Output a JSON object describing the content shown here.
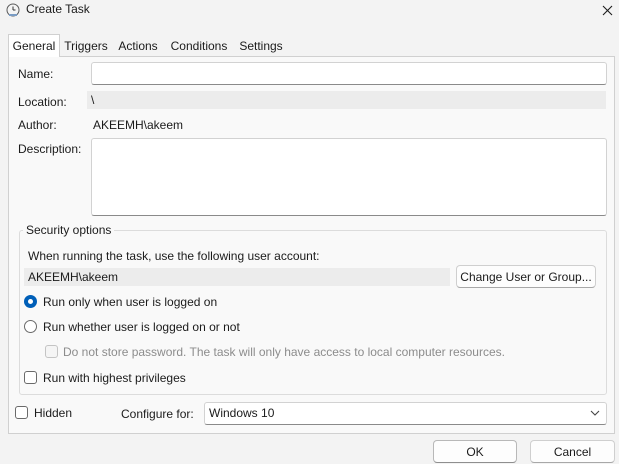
{
  "window": {
    "title": "Create Task",
    "icon": "task-scheduler-clock-icon"
  },
  "tabs": [
    {
      "label": "General",
      "active": true
    },
    {
      "label": "Triggers",
      "active": false
    },
    {
      "label": "Actions",
      "active": false
    },
    {
      "label": "Conditions",
      "active": false
    },
    {
      "label": "Settings",
      "active": false
    }
  ],
  "general": {
    "name_label": "Name:",
    "name_value": "",
    "location_label": "Location:",
    "location_value": "\\",
    "author_label": "Author:",
    "author_value": "AKEEMH\\akeem",
    "description_label": "Description:",
    "description_value": ""
  },
  "security": {
    "group_title": "Security options",
    "account_prompt": "When running the task, use the following user account:",
    "account_value": "AKEEMH\\akeem",
    "change_button": "Change User or Group...",
    "radio_logged_on": "Run only when user is logged on",
    "radio_whether": "Run whether user is logged on or not",
    "do_not_store": "Do not store password.  The task will only have access to local computer resources.",
    "highest_privileges": "Run with highest privileges",
    "selected_mode": "Run only when user is logged on"
  },
  "bottom": {
    "hidden_label": "Hidden",
    "configure_label": "Configure for:",
    "configure_value": "Windows 10"
  },
  "buttons": {
    "ok": "OK",
    "cancel": "Cancel"
  },
  "colors": {
    "accent": "#005fb8",
    "window_bg": "#f3f3f3"
  }
}
